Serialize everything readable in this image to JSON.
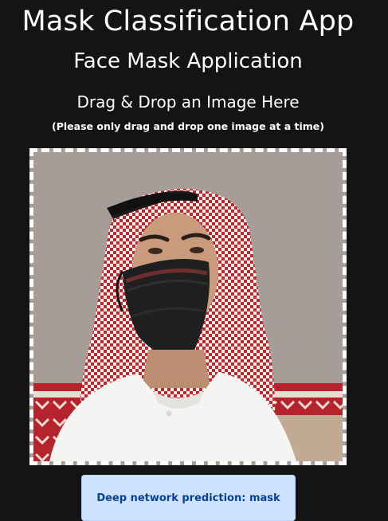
{
  "header": {
    "title": "Mask Classification App",
    "subtitle": "Face Mask Application"
  },
  "dropzone": {
    "heading": "Drag & Drop an Image Here",
    "note": "(Please only drag and drop one image at a time)",
    "image_subject": "man-wearing-black-face-mask-and-red-checkered-keffiyeh"
  },
  "result": {
    "label": "Deep network prediction: mask"
  },
  "colors": {
    "background": "#141414",
    "text": "#ffffff",
    "result_background": "#cfe2ff",
    "result_text": "#084298",
    "photo_background": "#a69d98"
  }
}
